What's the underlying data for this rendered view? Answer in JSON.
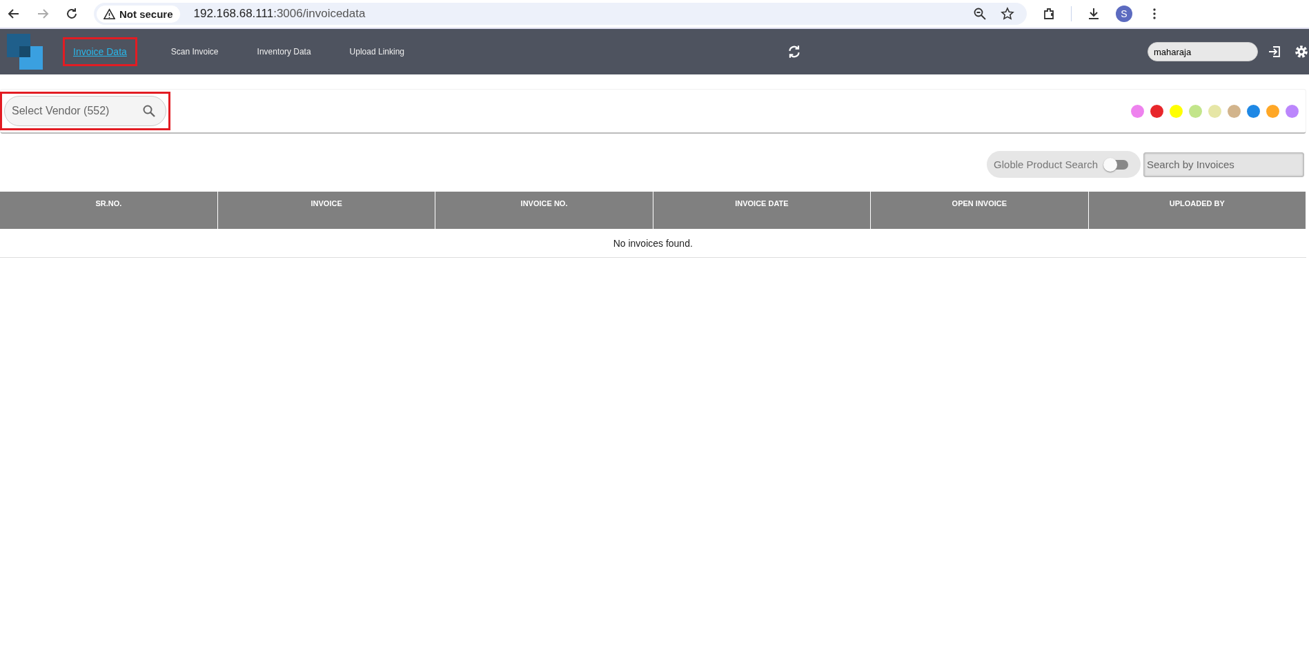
{
  "browser": {
    "security": "Not secure",
    "url_host": "192.168.68.111",
    "url_path": ":3006/invoicedata",
    "profile": "S"
  },
  "nav": {
    "tabs": [
      {
        "label": "Invoice Data",
        "selected": true,
        "highlighted": true
      },
      {
        "label": "Scan Invoice",
        "selected": false,
        "highlighted": false
      },
      {
        "label": "Inventory Data",
        "selected": false,
        "highlighted": false
      },
      {
        "label": "Upload Linking",
        "selected": false,
        "highlighted": false
      }
    ],
    "user_field": {
      "value": "maharaja"
    }
  },
  "vendor_search": {
    "placeholder": "Select Vendor (552)",
    "highlighted": true
  },
  "color_filters": [
    {
      "color": "#ee82ee"
    },
    {
      "color": "#e8262b"
    },
    {
      "color": "#ffff00"
    },
    {
      "color": "#c2e58a"
    },
    {
      "color": "#e6e6a6"
    },
    {
      "color": "#d2b48c"
    },
    {
      "color": "#1e88e5"
    },
    {
      "color": "#ffa726"
    },
    {
      "color": "#bb86fc"
    }
  ],
  "global_search": {
    "label": "Globle Product Search",
    "on": false
  },
  "invoice_search": {
    "placeholder": "Search by Invoices"
  },
  "table": {
    "columns": [
      "SR.NO.",
      "INVOICE",
      "INVOICE NO.",
      "INVOICE DATE",
      "OPEN INVOICE",
      "UPLOADED BY"
    ],
    "empty_message": "No invoices found."
  }
}
